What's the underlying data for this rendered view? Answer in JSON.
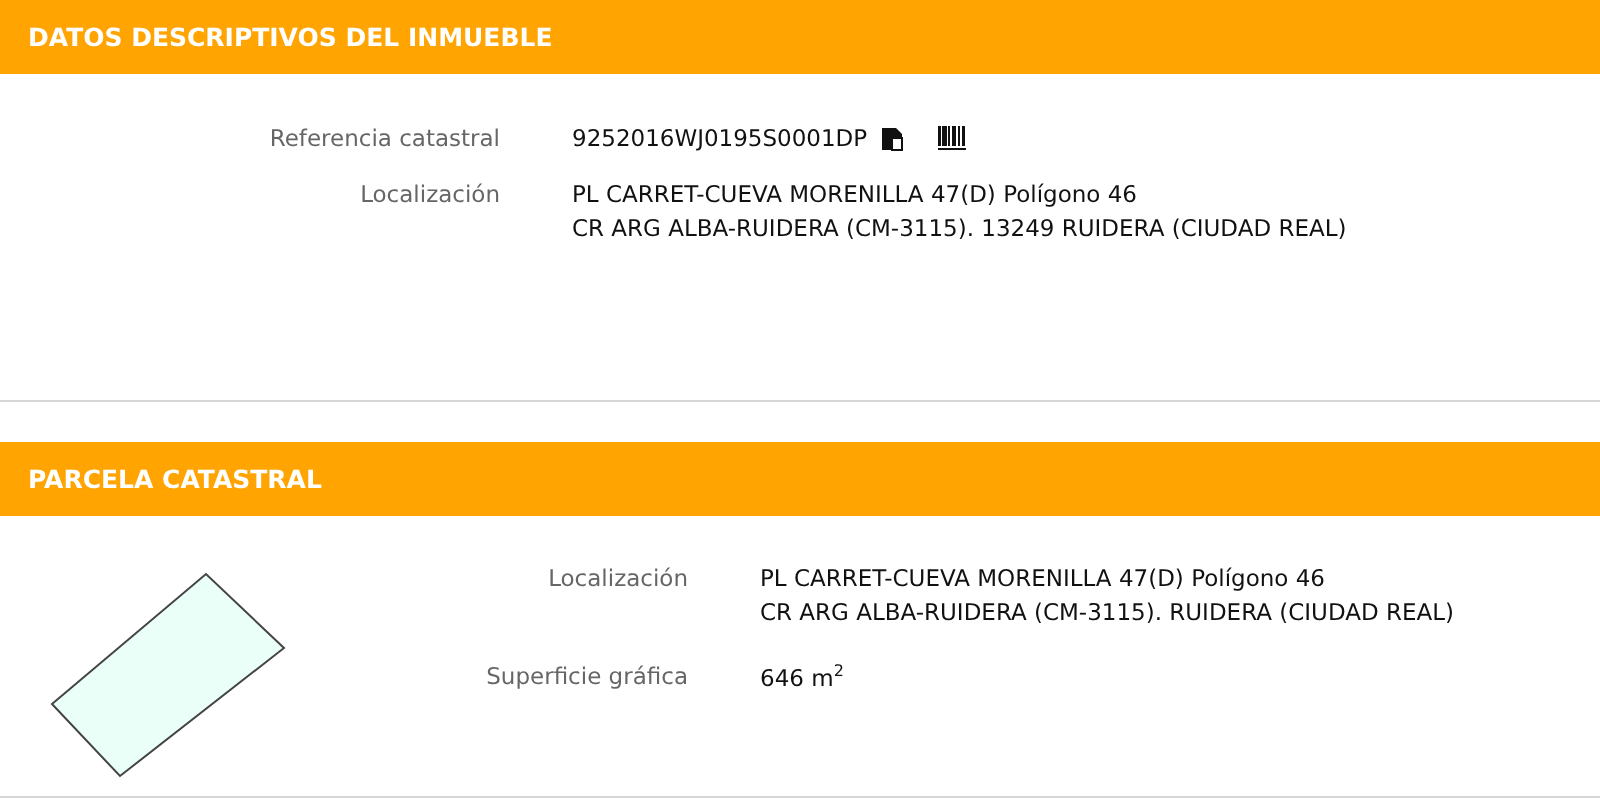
{
  "sections": [
    {
      "title": "DATOS DESCRIPTIVOS DEL INMUEBLE",
      "kind": "details",
      "fields": [
        {
          "label": "Referencia catastral",
          "lines": [
            "9252016WJ0195S0001DP"
          ],
          "kind": "reference"
        },
        {
          "label": "Localización",
          "lines": [
            "PL CARRET-CUEVA MORENILLA 47(D) Polígono 46",
            "CR ARG ALBA-RUIDERA (CM-3115). 13249 RUIDERA (CIUDAD REAL)"
          ],
          "kind": "text"
        }
      ]
    },
    {
      "title": "PARCELA CATASTRAL",
      "kind": "parcel",
      "fields": [
        {
          "label": "Localización",
          "lines": [
            "PL CARRET-CUEVA MORENILLA 47(D) Polígono 46",
            "CR ARG ALBA-RUIDERA (CM-3115). RUIDERA (CIUDAD REAL)"
          ],
          "kind": "text"
        },
        {
          "label": "Superficie gráfica",
          "lines": [
            "646 m$^{2}$"
          ],
          "kind": "text"
        }
      ]
    }
  ]
}
